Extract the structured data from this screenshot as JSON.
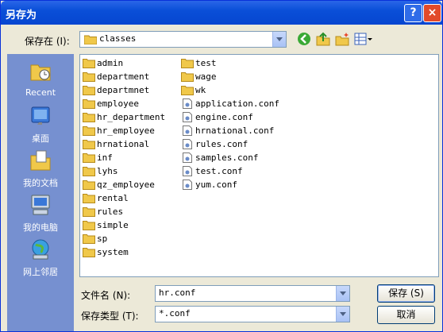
{
  "window": {
    "title": "另存为"
  },
  "location": {
    "label": "保存在 (I):",
    "value": "classes"
  },
  "places": [
    {
      "label": "Recent",
      "icon": "recent-folder-icon"
    },
    {
      "label": "桌面",
      "icon": "desktop-icon"
    },
    {
      "label": "我的文档",
      "icon": "my-documents-icon"
    },
    {
      "label": "我的电脑",
      "icon": "my-computer-icon"
    },
    {
      "label": "网上邻居",
      "icon": "network-places-icon"
    }
  ],
  "files": [
    {
      "name": "admin",
      "type": "folder"
    },
    {
      "name": "department",
      "type": "folder"
    },
    {
      "name": "departmnet",
      "type": "folder"
    },
    {
      "name": "employee",
      "type": "folder"
    },
    {
      "name": "hr_department",
      "type": "folder"
    },
    {
      "name": "hr_employee",
      "type": "folder"
    },
    {
      "name": "hrnational",
      "type": "folder"
    },
    {
      "name": "inf",
      "type": "folder"
    },
    {
      "name": "lyhs",
      "type": "folder"
    },
    {
      "name": "qz_employee",
      "type": "folder"
    },
    {
      "name": "rental",
      "type": "folder"
    },
    {
      "name": "rules",
      "type": "folder"
    },
    {
      "name": "simple",
      "type": "folder"
    },
    {
      "name": "sp",
      "type": "folder"
    },
    {
      "name": "system",
      "type": "folder"
    },
    {
      "name": "test",
      "type": "folder"
    },
    {
      "name": "wage",
      "type": "folder"
    },
    {
      "name": "wk",
      "type": "folder"
    },
    {
      "name": "application.conf",
      "type": "file"
    },
    {
      "name": "engine.conf",
      "type": "file"
    },
    {
      "name": "hrnational.conf",
      "type": "file"
    },
    {
      "name": "rules.conf",
      "type": "file"
    },
    {
      "name": "samples.conf",
      "type": "file"
    },
    {
      "name": "test.conf",
      "type": "file"
    },
    {
      "name": "yum.conf",
      "type": "file"
    }
  ],
  "filename": {
    "label": "文件名 (N):",
    "value": "hr.conf"
  },
  "filetype": {
    "label": "保存类型 (T):",
    "value": "*.conf"
  },
  "buttons": {
    "save": "保存 (S)",
    "cancel": "取消",
    "help": "?",
    "close": "×"
  }
}
